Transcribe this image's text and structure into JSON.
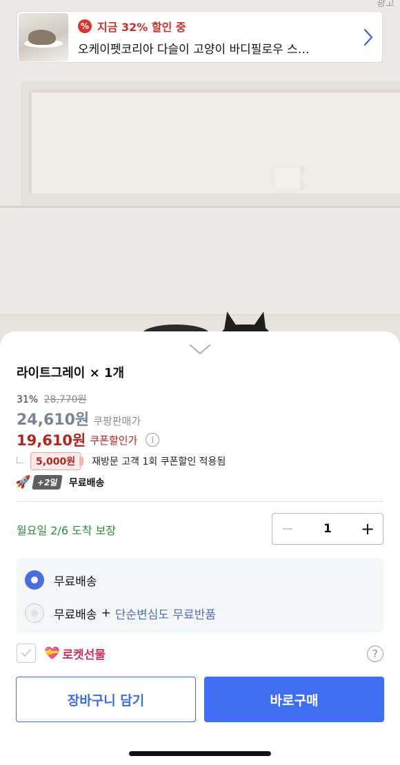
{
  "ad": {
    "corner_label": "광고",
    "headline": "지금 32% 할인 중",
    "badge_symbol": "%",
    "product": "오케이펫코리아 다슬이 고양이 바디필로우 스…"
  },
  "sheet": {
    "option_title": "라이트그레이 × 1개",
    "discount_percent": "31%",
    "original_price": "28,770원",
    "sale_price": "24,610원",
    "sale_label": "쿠팡판매가",
    "coupon_price": "19,610원",
    "coupon_label": "쿠폰할인가",
    "info_symbol": "i",
    "coupon_amount": "5,000원",
    "coupon_desc": "재방문 고객 1회 쿠폰할인 적용됨",
    "delivery_days_badge": "+2일",
    "delivery_type": "무료배송",
    "arrival_text": "월요일 2/6 도착 보장",
    "quantity": "1",
    "shipping_options": {
      "option1": "무료배송",
      "option2_prefix": "무료배송",
      "option2_plus": "+",
      "option2_link": "단순변심도 무료반품",
      "selected": "option1"
    },
    "gift_label": "로켓선물",
    "gift_checked": false,
    "help_symbol": "?",
    "cart_button": "장바구니 담기",
    "buy_button": "바로구매"
  },
  "colors": {
    "primary_blue": "#3f6ef2",
    "coupon_red": "#b0261f",
    "arrival_green": "#2e8b3d",
    "link_blue": "#4a6fb3"
  },
  "icons": {
    "ad_badge": "percent-badge-icon",
    "ad_arrow": "chevron-right-icon",
    "sheet_handle": "chevron-down-icon",
    "info": "info-icon",
    "rocket": "rocket-icon",
    "gift": "heart-gift-icon",
    "help": "question-icon"
  }
}
